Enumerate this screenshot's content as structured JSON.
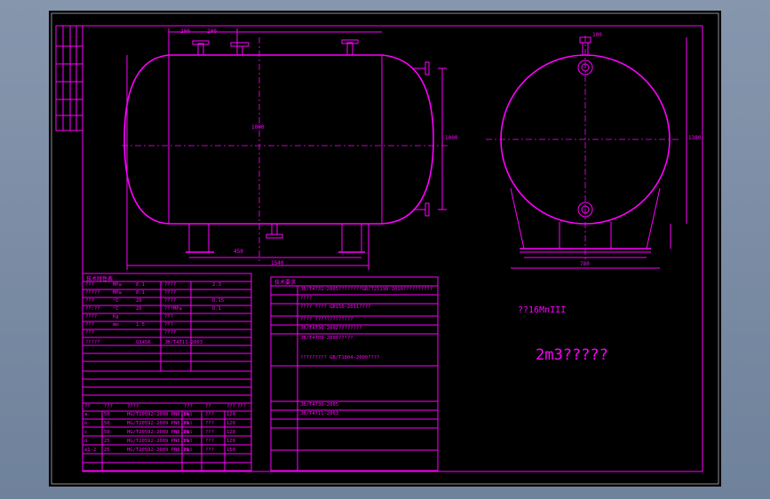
{
  "drawing": {
    "material_label": "??16MnIII",
    "title_label": "2m3?????",
    "colors": {
      "background": "#000000",
      "lines": "#ff00ff",
      "viewport": "#7b8ea6"
    },
    "dims": {
      "front_top_a": "200",
      "front_top_b": "200",
      "front_side_h": "1000",
      "front_inner_h": "1000",
      "front_bottom_a": "450",
      "front_bottom_b": "1540",
      "side_top": "100",
      "side_h": "1380",
      "side_w": "780"
    }
  },
  "tables": {
    "design": {
      "title": "技术特性表",
      "rows": [
        [
          "???",
          "MPa",
          "0.1",
          "????",
          "2.3"
        ],
        [
          "?????",
          "MPa",
          "0.1",
          "????",
          ""
        ],
        [
          "???",
          "°C",
          "20",
          "????",
          "0.15"
        ],
        [
          "??:??",
          "°C",
          "20",
          "???MPa",
          "0.1"
        ],
        [
          "????",
          "Kg",
          "",
          "???",
          ""
        ],
        [
          "???",
          "mm",
          "1.5",
          "???",
          ""
        ],
        [
          "???",
          "",
          "",
          "????",
          ""
        ],
        [
          "?????",
          "",
          "Q345R",
          "JB/T4711-2003",
          ""
        ]
      ]
    },
    "nozzles": {
      "header": [
        "??",
        "???",
        "????",
        "???",
        "??",
        "???",
        "???"
      ],
      "rows": [
        [
          "a",
          "50",
          "HG/T20592-2009 PN0.10",
          "fal",
          "???",
          "120"
        ],
        [
          "b",
          "50",
          "HG/T20592-2009 PN0.10",
          "fal",
          "???",
          "120"
        ],
        [
          "c",
          "50",
          "HG/T20592-2009 PN0.10",
          "fal",
          "???",
          "120"
        ],
        [
          "d",
          "25",
          "HG/T20592-2009 PN0.10",
          "fal",
          "???",
          "120"
        ],
        [
          "e1-2",
          "25",
          "HG/T20592-2009 PN0.10",
          "fal",
          "???",
          "150"
        ]
      ]
    },
    "requirements": {
      "title": "技术要求",
      "lines": [
        "JB/T4731-2005????????GB/T25198-2010??????????",
        "????",
        "???? ???? GB150-2011????",
        "???? ?????????????",
        "JB/T4736-2002????????",
        "JB/T4709-2000?????",
        "?????????  GB/T1804-2000????",
        "JB/T4730-2005",
        "JB/T4711-2003"
      ]
    }
  }
}
